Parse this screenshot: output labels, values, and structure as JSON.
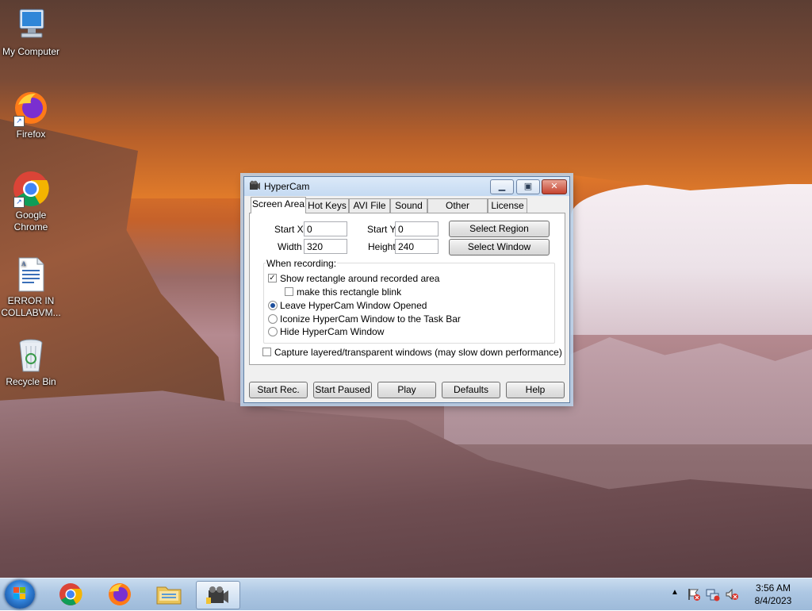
{
  "desktop": {
    "icons": [
      {
        "label": "My Computer",
        "icon": "computer-icon"
      },
      {
        "label": "Firefox",
        "icon": "firefox-icon"
      },
      {
        "label": "Google Chrome",
        "icon": "chrome-icon"
      },
      {
        "label": "ERROR IN COLLABVM...",
        "icon": "document-icon"
      },
      {
        "label": "Recycle Bin",
        "icon": "recycle-bin-icon"
      }
    ]
  },
  "window": {
    "title": "HyperCam",
    "tabs": [
      "Screen Area",
      "Hot Keys",
      "AVI File",
      "Sound",
      "Other Options",
      "License"
    ],
    "active_tab": "Screen Area",
    "fields": {
      "start_x_label": "Start X",
      "start_x": "0",
      "start_y_label": "Start Y",
      "start_y": "0",
      "width_label": "Width",
      "width": "320",
      "height_label": "Height",
      "height": "240"
    },
    "select_region": "Select Region",
    "select_window": "Select Window",
    "when_recording": "When recording:",
    "options": {
      "show_rect": {
        "label": "Show rectangle around recorded area",
        "checked": true
      },
      "blink": {
        "label": "make this rectangle blink",
        "checked": false
      },
      "leave_open": {
        "label": "Leave HyperCam Window Opened",
        "selected": true
      },
      "iconize": {
        "label": "Iconize HyperCam Window to the Task Bar",
        "selected": false
      },
      "hide": {
        "label": "Hide HyperCam Window",
        "selected": false
      },
      "layered": {
        "label": "Capture layered/transparent windows (may slow down performance)",
        "checked": false
      }
    },
    "buttons": [
      "Start Rec.",
      "Start Paused",
      "Play",
      "Defaults",
      "Help"
    ]
  },
  "taskbar": {
    "time": "3:56 AM",
    "date": "8/4/2023"
  },
  "colors": {
    "taskbar": "#adc7e3",
    "window_frame": "#c5daf2",
    "accent": "#1d4f9c"
  }
}
